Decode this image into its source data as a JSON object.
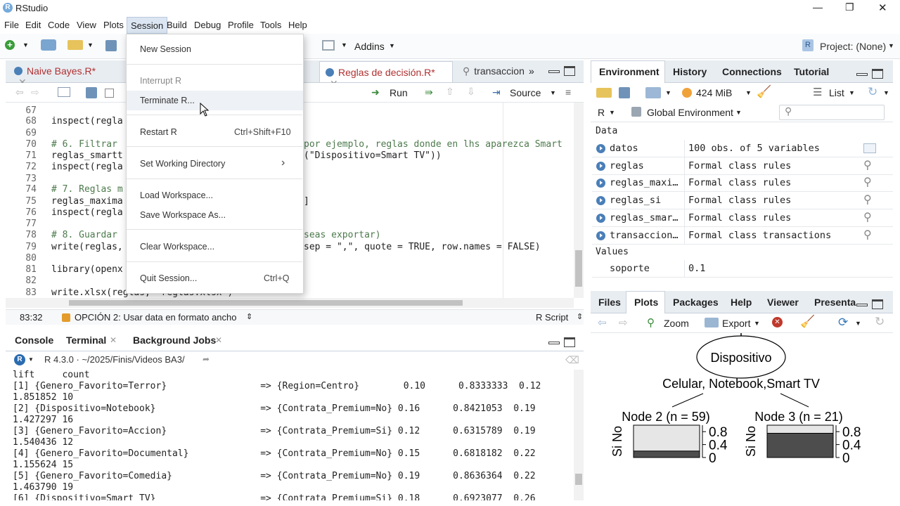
{
  "window": {
    "title": "RStudio",
    "controls": [
      "—",
      "❐",
      "✕"
    ]
  },
  "menubar": [
    "File",
    "Edit",
    "Code",
    "View",
    "Plots",
    "Session",
    "Build",
    "Debug",
    "Profile",
    "Tools",
    "Help"
  ],
  "toolbar": {
    "addins": "Addins",
    "project": "Project: (None)"
  },
  "editor": {
    "tabs": [
      {
        "label": "Naive Bayes.R*"
      },
      {
        "label": "Reglas de decisión.R*"
      },
      {
        "label": "transaccion"
      }
    ],
    "buttons": {
      "run": "Run",
      "source": "Source"
    },
    "lines": [
      {
        "n": "67",
        "t": ""
      },
      {
        "n": "68",
        "t": "inspect(regla"
      },
      {
        "n": "69",
        "t": ""
      },
      {
        "n": "70",
        "t": "# 6. Filtrar",
        "tail": "por ejemplo, reglas donde en lhs aparezca Smart"
      },
      {
        "n": "71",
        "t": "reglas_smartt",
        "tail": "(\"Dispositivo=Smart TV\"))"
      },
      {
        "n": "72",
        "t": "inspect(regla"
      },
      {
        "n": "73",
        "t": ""
      },
      {
        "n": "74",
        "t": "# 7. Reglas m"
      },
      {
        "n": "75",
        "t": "reglas_maxima",
        "tail": "]"
      },
      {
        "n": "76",
        "t": "inspect(regla"
      },
      {
        "n": "77",
        "t": ""
      },
      {
        "n": "78",
        "t": "# 8. Guardar",
        "tail": "seas exportar)"
      },
      {
        "n": "79",
        "t": "write(reglas,",
        "tail": "sep = \",\", quote = TRUE, row.names = FALSE)"
      },
      {
        "n": "80",
        "t": ""
      },
      {
        "n": "81",
        "t": "library(openx"
      },
      {
        "n": "82",
        "t": ""
      },
      {
        "n": "83",
        "t": "write.xlsx(reglas, \"reglas.xlsx\")"
      }
    ],
    "status": {
      "position": "83:32",
      "section": "OPCIÓN 2: Usar data en formato ancho",
      "type": "R Script"
    }
  },
  "session_menu": {
    "items": [
      {
        "label": "New Session",
        "shortcut": ""
      },
      {
        "label": "Interrupt R",
        "shortcut": "",
        "disabled": true
      },
      {
        "label": "Terminate R...",
        "shortcut": ""
      },
      {
        "label": "Restart R",
        "shortcut": "Ctrl+Shift+F10"
      },
      {
        "label": "Set Working Directory",
        "shortcut": "›"
      },
      {
        "label": "Load Workspace...",
        "shortcut": ""
      },
      {
        "label": "Save Workspace As...",
        "shortcut": ""
      },
      {
        "label": "Clear Workspace...",
        "shortcut": ""
      },
      {
        "label": "Quit Session...",
        "shortcut": "Ctrl+Q"
      }
    ]
  },
  "console": {
    "tabs": [
      "Console",
      "Terminal",
      "Background Jobs"
    ],
    "path": "R 4.3.0 · ~/2025/Finis/Videos BA3/",
    "lines": [
      "lift     count",
      "[1] {Genero_Favorito=Terror}                 => {Region=Centro}        0.10      0.8333333  0.12",
      "1.851852 10",
      "[2] {Dispositivo=Notebook}                   => {Contrata_Premium=No} 0.16      0.8421053  0.19",
      "1.427297 16",
      "[3] {Genero_Favorito=Accion}                 => {Contrata_Premium=Si} 0.12      0.6315789  0.19",
      "1.540436 12",
      "[4] {Genero_Favorito=Documental}             => {Contrata_Premium=No} 0.15      0.6818182  0.22",
      "1.155624 15",
      "[5] {Genero_Favorito=Comedia}                => {Contrata_Premium=No} 0.19      0.8636364  0.22",
      "1.463790 19",
      "[6] {Dispositivo=Smart_TV}                   => {Contrata_Premium=Si} 0.18      0.6923077  0.26"
    ]
  },
  "environment": {
    "tabs": [
      "Environment",
      "History",
      "Connections",
      "Tutorial"
    ],
    "memory": "424 MiB",
    "view": "List",
    "scope": "R",
    "env": "Global Environment",
    "data_header": "Data",
    "data": [
      {
        "name": "datos",
        "value": "100 obs. of 5 variables"
      },
      {
        "name": "reglas",
        "value": "Formal class  rules"
      },
      {
        "name": "reglas_maxi…",
        "value": "Formal class  rules"
      },
      {
        "name": "reglas_si",
        "value": "Formal class  rules"
      },
      {
        "name": "reglas_smar…",
        "value": "Formal class  rules"
      },
      {
        "name": "transaccion…",
        "value": "Formal class  transactions"
      }
    ],
    "values_header": "Values",
    "values": [
      {
        "name": "soporte",
        "value": "0.1"
      }
    ]
  },
  "files": {
    "tabs": [
      "Files",
      "Plots",
      "Packages",
      "Help",
      "Viewer",
      "Presenta"
    ],
    "zoom": "Zoom",
    "export": "Export"
  },
  "tree_plot": {
    "root": "Dispositivo",
    "split": "Celular, Notebook,Smart TV",
    "nodes": [
      {
        "label": "Node 2 (n = 59)",
        "si_fraction": 0.2,
        "no_fraction": 0.8
      },
      {
        "label": "Node 3 (n = 21)",
        "si_fraction": 0.75,
        "no_fraction": 0.25
      }
    ],
    "axis_ticks": [
      "0.8",
      "0.4",
      "0"
    ],
    "y_labels": "Si No"
  }
}
